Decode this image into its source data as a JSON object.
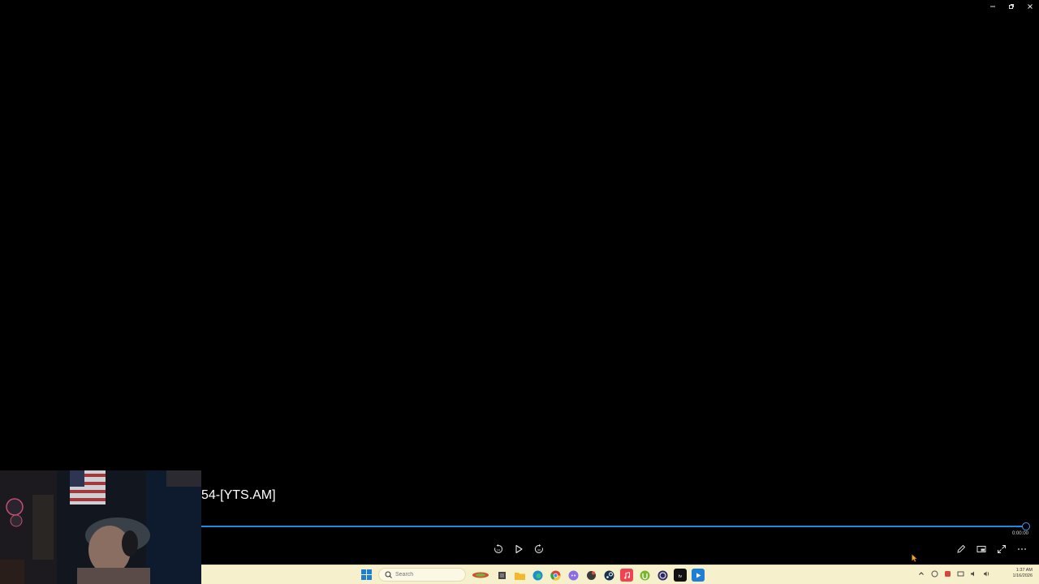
{
  "window": {
    "controls": [
      {
        "name": "minimize-icon",
        "label": "Minimize"
      },
      {
        "name": "restore-icon",
        "label": "Restore"
      },
      {
        "name": "close-icon",
        "label": "Close"
      }
    ]
  },
  "player": {
    "title": "54-[YTS.AM]",
    "time": "0:00:00",
    "progress_fraction": 1.0,
    "accent_color": "#1e88e5",
    "center_controls": [
      "skip-back-10-icon",
      "play-icon",
      "skip-forward-30-icon"
    ],
    "right_controls": [
      "edit-pencil-icon",
      "miniplayer-icon",
      "fullscreen-icon",
      "more-options-icon"
    ]
  },
  "taskbar": {
    "search_placeholder": "Search",
    "pinned_apps": [
      "cast-icon",
      "file-explorer-icon",
      "folder-icon",
      "edge-icon",
      "chrome-icon",
      "discord-icon",
      "app-icon",
      "steam-icon",
      "music-icon",
      "utorrent-icon",
      "obs-icon",
      "apple-tv-icon",
      "media-player-icon"
    ],
    "tray_icons": [
      "chevron-up-icon",
      "tray-app-icon",
      "tray-app2-icon",
      "network-icon",
      "speaker-icon",
      "volume-icon"
    ],
    "clock_time": "1:37 AM",
    "clock_date": "1/16/2026",
    "background_color": "#f6f0cc"
  }
}
